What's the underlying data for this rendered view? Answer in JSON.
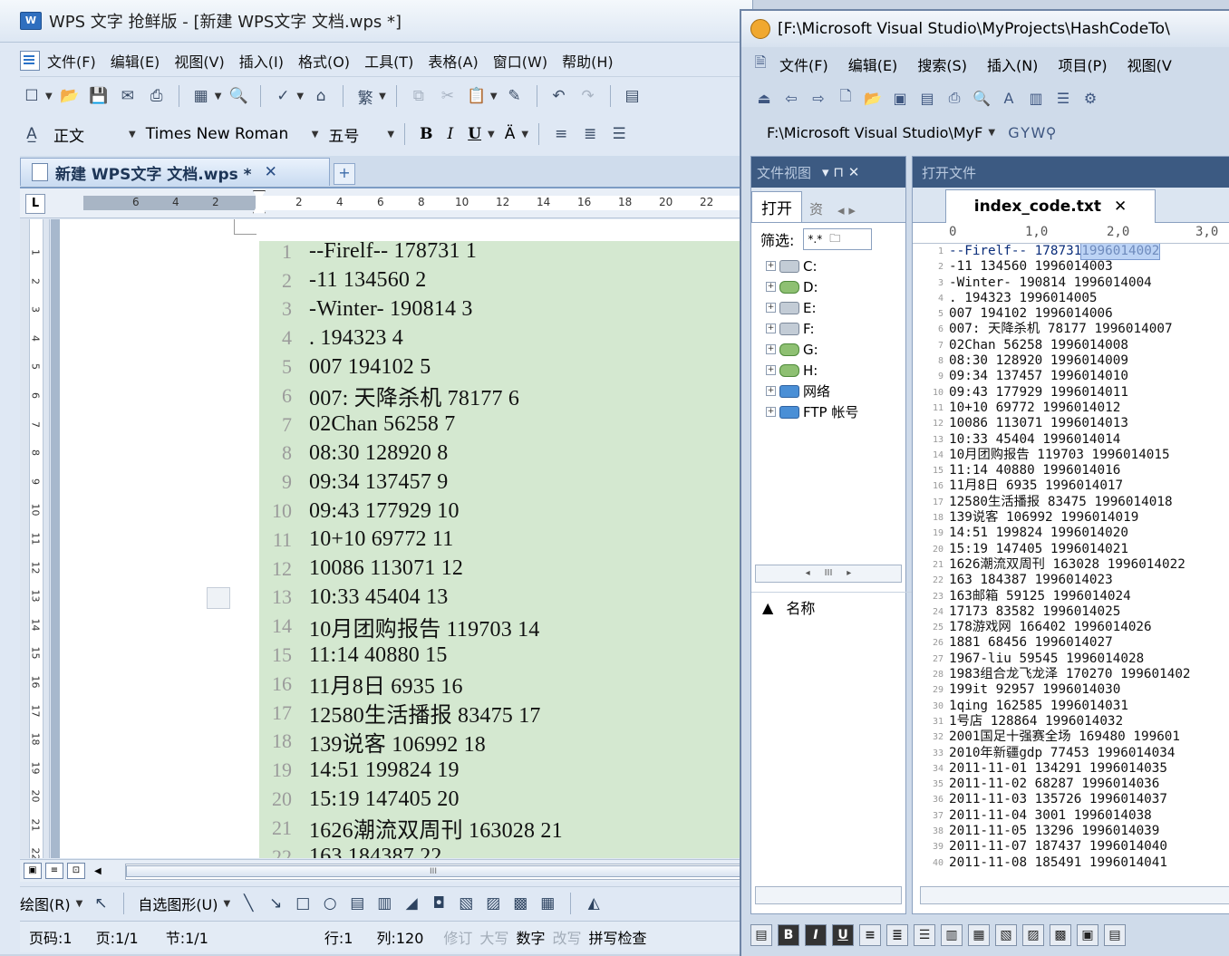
{
  "wps": {
    "app_icon": "W",
    "title": "WPS 文字 抢鲜版 - [新建 WPS文字 文档.wps *]",
    "menu": [
      "文件(F)",
      "编辑(E)",
      "视图(V)",
      "插入(I)",
      "格式(O)",
      "工具(T)",
      "表格(A)",
      "窗口(W)",
      "帮助(H)"
    ],
    "style_value": "正文",
    "font_value": "Times New Roman",
    "size_value": "五号",
    "trad_label": "繁",
    "doc_tab": "新建 WPS文字 文档.wps *",
    "ruler_ticks": [
      "6",
      "4",
      "2",
      "2",
      "4",
      "6",
      "8",
      "10",
      "12",
      "14",
      "16",
      "18",
      "20",
      "22"
    ],
    "vruler_ticks": [
      "1",
      "2",
      "3",
      "4",
      "5",
      "6",
      "7",
      "8",
      "9",
      "10",
      "11",
      "12",
      "13",
      "14",
      "15",
      "16",
      "17",
      "18",
      "19",
      "20",
      "21",
      "22"
    ],
    "lines": [
      {
        "n": "1",
        "t": "--Firelf-- 178731 1"
      },
      {
        "n": "2",
        "t": "-11 134560 2"
      },
      {
        "n": "3",
        "t": "-Winter- 190814 3"
      },
      {
        "n": "4",
        "t": ". 194323 4"
      },
      {
        "n": "5",
        "t": "007 194102 5"
      },
      {
        "n": "6",
        "t": "007: 天降杀机 78177 6"
      },
      {
        "n": "7",
        "t": "02Chan 56258 7"
      },
      {
        "n": "8",
        "t": "08:30 128920 8"
      },
      {
        "n": "9",
        "t": "09:34 137457 9"
      },
      {
        "n": "10",
        "t": "09:43 177929 10"
      },
      {
        "n": "11",
        "t": "10+10 69772 11"
      },
      {
        "n": "12",
        "t": "10086 113071 12"
      },
      {
        "n": "13",
        "t": "10:33 45404 13"
      },
      {
        "n": "14",
        "t": "10月团购报告 119703 14"
      },
      {
        "n": "15",
        "t": "11:14 40880 15"
      },
      {
        "n": "16",
        "t": "11月8日 6935 16"
      },
      {
        "n": "17",
        "t": "12580生活播报 83475 17"
      },
      {
        "n": "18",
        "t": "139说客 106992 18"
      },
      {
        "n": "19",
        "t": "14:51 199824 19"
      },
      {
        "n": "20",
        "t": "15:19 147405 20"
      },
      {
        "n": "21",
        "t": "1626潮流双周刊 163028 21"
      },
      {
        "n": "22",
        "t": "163 184387 22"
      }
    ],
    "draw_label": "绘图(R)",
    "autoshape_label": "自选图形(U)",
    "status": {
      "page_code": "页码:1",
      "page": "页:1/1",
      "section": "节:1/1",
      "row": "行:1",
      "col": "列:120",
      "revise": "修订",
      "caps": "大写",
      "num": "数字",
      "overwrite": "改写",
      "spell": "拼写检查"
    }
  },
  "vs": {
    "title": "[F:\\Microsoft Visual Studio\\MyProjects\\HashCodeTo\\",
    "menu": [
      "文件(F)",
      "编辑(E)",
      "搜索(S)",
      "插入(N)",
      "项目(P)",
      "视图(V"
    ],
    "path_combo": "F:\\Microsoft Visual Studio\\MyF",
    "file_view_title": "文件视图",
    "file_view_controls": "▾ ⊓ ✕",
    "open_file_title": "打开文件",
    "tab_open": "打开",
    "tab_other": "资",
    "filter_label": "筛选:",
    "filter_value": "*.*",
    "drives": [
      "C:",
      "D:",
      "E:",
      "F:",
      "G:",
      "H:",
      "网络",
      "FTP 帐号"
    ],
    "name_col": "名称",
    "file_tab": "index_code.txt",
    "code_ruler": [
      "0",
      "1,0",
      "2,0",
      "3,0"
    ],
    "code": [
      {
        "n": "1",
        "a": "--Firelf-- 178731 ",
        "b": "1996014002"
      },
      {
        "n": "2",
        "a": "-11 134560 1996014003"
      },
      {
        "n": "3",
        "a": "-Winter- 190814 1996014004"
      },
      {
        "n": "4",
        "a": ". 194323 1996014005"
      },
      {
        "n": "5",
        "a": "007 194102 1996014006"
      },
      {
        "n": "6",
        "a": "007: 天降杀机 78177 1996014007"
      },
      {
        "n": "7",
        "a": "02Chan 56258 1996014008"
      },
      {
        "n": "8",
        "a": "08:30 128920 1996014009"
      },
      {
        "n": "9",
        "a": "09:34 137457 1996014010"
      },
      {
        "n": "10",
        "a": "09:43 177929 1996014011"
      },
      {
        "n": "11",
        "a": "10+10 69772 1996014012"
      },
      {
        "n": "12",
        "a": "10086 113071 1996014013"
      },
      {
        "n": "13",
        "a": "10:33 45404 1996014014"
      },
      {
        "n": "14",
        "a": "10月团购报告 119703 1996014015"
      },
      {
        "n": "15",
        "a": "11:14 40880 1996014016"
      },
      {
        "n": "16",
        "a": "11月8日 6935 1996014017"
      },
      {
        "n": "17",
        "a": "12580生活播报 83475 1996014018"
      },
      {
        "n": "18",
        "a": "139说客 106992 1996014019"
      },
      {
        "n": "19",
        "a": "14:51 199824 1996014020"
      },
      {
        "n": "20",
        "a": "15:19 147405 1996014021"
      },
      {
        "n": "21",
        "a": "1626潮流双周刊 163028 1996014022"
      },
      {
        "n": "22",
        "a": "163 184387 1996014023"
      },
      {
        "n": "23",
        "a": "163邮箱 59125 1996014024"
      },
      {
        "n": "24",
        "a": "17173 83582 1996014025"
      },
      {
        "n": "25",
        "a": "178游戏网 166402 1996014026"
      },
      {
        "n": "26",
        "a": "1881 68456 1996014027"
      },
      {
        "n": "27",
        "a": "1967-liu 59545 1996014028"
      },
      {
        "n": "28",
        "a": "1983组合龙飞龙泽 170270 199601402"
      },
      {
        "n": "29",
        "a": "199it 92957 1996014030"
      },
      {
        "n": "30",
        "a": "1qing 162585 1996014031"
      },
      {
        "n": "31",
        "a": "1号店 128864 1996014032"
      },
      {
        "n": "32",
        "a": "2001国足十强赛全场 169480 199601"
      },
      {
        "n": "33",
        "a": "2010年新疆gdp 77453 1996014034"
      },
      {
        "n": "34",
        "a": "2011-11-01 134291 1996014035"
      },
      {
        "n": "35",
        "a": "2011-11-02 68287 1996014036"
      },
      {
        "n": "36",
        "a": "2011-11-03 135726 1996014037"
      },
      {
        "n": "37",
        "a": "2011-11-04 3001 1996014038"
      },
      {
        "n": "38",
        "a": "2011-11-05 13296 1996014039"
      },
      {
        "n": "39",
        "a": "2011-11-07 187437 1996014040"
      },
      {
        "n": "40",
        "a": "2011-11-08 185491 1996014041"
      }
    ],
    "bottom_buttons": [
      "B",
      "I",
      "U"
    ]
  },
  "colors": {
    "highlight": "#d4e8d0",
    "title_bar": "#3c5a82",
    "selection": "#bcd3f5"
  }
}
